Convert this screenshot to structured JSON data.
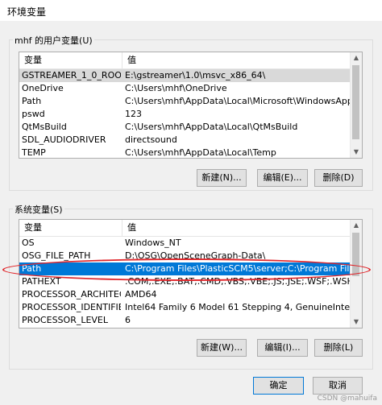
{
  "window": {
    "title": "环境变量"
  },
  "user_section": {
    "label": "mhf 的用户变量(U)",
    "columns": [
      "变量",
      "值"
    ],
    "rows": [
      {
        "name": "GSTREAMER_1_0_ROOT_...",
        "value": "E:\\gstreamer\\1.0\\msvc_x86_64\\"
      },
      {
        "name": "OneDrive",
        "value": "C:\\Users\\mhf\\OneDrive"
      },
      {
        "name": "Path",
        "value": "C:\\Users\\mhf\\AppData\\Local\\Microsoft\\WindowsApps;D:\\zip..."
      },
      {
        "name": "pswd",
        "value": "123"
      },
      {
        "name": "QtMsBuild",
        "value": "C:\\Users\\mhf\\AppData\\Local\\QtMsBuild"
      },
      {
        "name": "SDL_AUDIODRIVER",
        "value": "directsound"
      },
      {
        "name": "TEMP",
        "value": "C:\\Users\\mhf\\AppData\\Local\\Temp"
      }
    ],
    "buttons": {
      "new": "新建(N)...",
      "edit": "编辑(E)...",
      "delete": "删除(D)"
    }
  },
  "system_section": {
    "label": "系统变量(S)",
    "columns": [
      "变量",
      "值"
    ],
    "rows": [
      {
        "name": "OS",
        "value": "Windows_NT"
      },
      {
        "name": "OSG_FILE_PATH",
        "value": "D:\\OSG\\OpenSceneGraph-Data\\"
      },
      {
        "name": "Path",
        "value": "C:\\Program Files\\PlasticSCM5\\server;C:\\Program Files\\Plastic..."
      },
      {
        "name": "PATHEXT",
        "value": ".COM;.EXE;.BAT;.CMD;.VBS;.VBE;.JS;.JSE;.WSF;.WSH;.MSC"
      },
      {
        "name": "PROCESSOR_ARCHITECT...",
        "value": "AMD64"
      },
      {
        "name": "PROCESSOR_IDENTIFIER",
        "value": "Intel64 Family 6 Model 61 Stepping 4, GenuineIntel"
      },
      {
        "name": "PROCESSOR_LEVEL",
        "value": "6"
      }
    ],
    "buttons": {
      "new": "新建(W)...",
      "edit": "编辑(I)...",
      "delete": "删除(L)"
    }
  },
  "footer": {
    "ok": "确定",
    "cancel": "取消"
  },
  "watermark": "CSDN @mahuifa",
  "colors": {
    "selection": "#0078d7",
    "annotation": "#e0262b"
  }
}
